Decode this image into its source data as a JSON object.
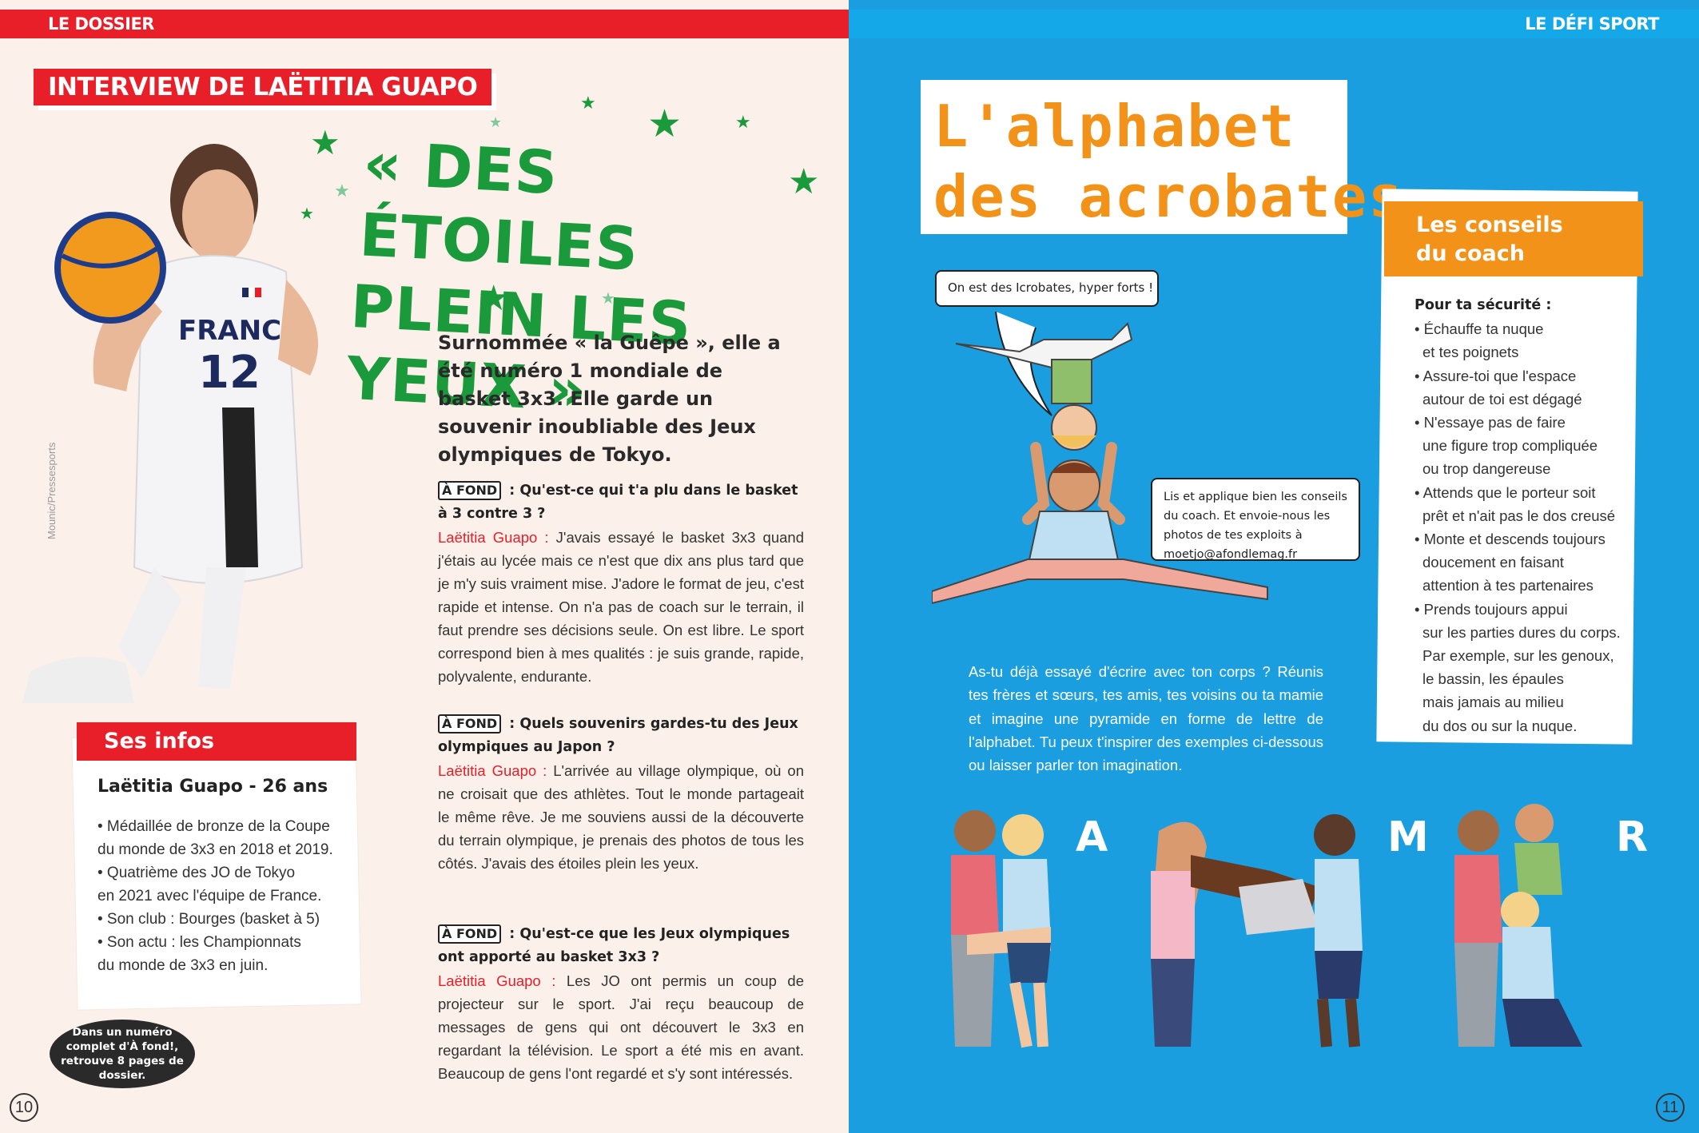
{
  "header": {
    "left_section": "LE DOSSIER",
    "right_section": "LE DÉFI SPORT"
  },
  "colors": {
    "red": "#e81e28",
    "green": "#1b9a3c",
    "blue": "#1a9ee0",
    "orange": "#f39218"
  },
  "left_page": {
    "tag": "INTERVIEW DE LAËTITIA GUAPO",
    "headline_line1": "« DES ÉTOILES",
    "headline_line2": "PLEIN LES YEUX »",
    "photo_credit": "Mounic/Pressesports",
    "jersey_text": "FRANCE",
    "jersey_number": "12",
    "intro": "Surnommée « la Guêpe », elle a été numéro 1 mondiale de basket 3x3. Elle garde un souvenir inoubliable des Jeux olympiques de Tokyo.",
    "qa": [
      {
        "badge": "À FOND",
        "question": " : Qu'est-ce qui t'a plu dans le basket à 3 contre 3 ?",
        "speaker": "Laëtitia Guapo :",
        "answer": " J'avais essayé le basket 3x3 quand j'étais au lycée mais ce n'est que dix ans plus tard que je m'y suis vraiment mise. J'adore le format de jeu, c'est rapide et intense. On n'a pas de coach sur le terrain, il faut prendre ses décisions seule. On est libre. Le sport correspond bien à mes qualités : je suis grande, rapide, polyvalente, endurante."
      },
      {
        "badge": "À FOND",
        "question": " : Quels souvenirs gardes-tu des Jeux olympiques au Japon ?",
        "speaker": "Laëtitia Guapo :",
        "answer": " L'arrivée au village olympique, où on ne croisait que des athlètes. Tout le monde partageait le même rêve. Je me souviens aussi de la découverte du terrain olympique, je prenais des photos de tous les côtés. J'avais des étoiles plein les yeux."
      },
      {
        "badge": "À FOND",
        "question": " : Qu'est-ce que les Jeux olympiques ont apporté au basket 3x3 ?",
        "speaker": "Laëtitia Guapo :",
        "answer": " Les JO ont permis un coup de projecteur sur le sport. J'ai reçu beaucoup de messages de gens qui ont découvert le 3x3 en regardant la télévision. Le sport a été mis en avant. Beaucoup de gens l'ont regardé et s'y sont intéressés."
      }
    ],
    "infos": {
      "title": "Ses infos",
      "name": "Laëtitia Guapo - 26 ans",
      "items": [
        [
          "• Médaillée de bronze de la Coupe",
          "du monde de 3x3 en 2018 et 2019."
        ],
        [
          "• Quatrième des JO de Tokyo",
          "en 2021 avec l'équipe de France."
        ],
        [
          "• Son club : Bourges (basket à 5)"
        ],
        [
          "• Son actu : les Championnats",
          "du monde de 3x3 en juin."
        ]
      ]
    },
    "bubble": "Dans un numéro complet d'À fond!, retrouve 8 pages de dossier.",
    "page_number": "10"
  },
  "right_page": {
    "title_line1": "L'alphabet",
    "title_line2": "des acrobates",
    "speech1": "On est des Icrobates, hyper forts !",
    "speech2": "Lis et applique bien les conseils du coach. Et envoie-nous les photos de tes exploits à moetjo@afondlemag.fr",
    "coach": {
      "title_line1": "Les conseils",
      "title_line2": "du coach",
      "head": "Pour ta sécurité :",
      "items": [
        [
          "• Échauffe ta nuque",
          "et tes poignets"
        ],
        [
          "• Assure-toi que l'espace",
          "autour de toi est dégagé"
        ],
        [
          "• N'essaye pas de faire",
          "une figure trop compliquée",
          "ou trop dangereuse"
        ],
        [
          "• Attends que le porteur soit",
          "prêt et n'ait pas le dos creusé"
        ],
        [
          "• Monte et descends toujours",
          "doucement en faisant",
          "attention à tes partenaires"
        ],
        [
          "• Prends toujours appui",
          "sur les parties dures du corps.",
          "Par exemple, sur les genoux,",
          "le bassin, les épaules",
          "mais jamais au milieu",
          "du dos ou sur la nuque."
        ]
      ]
    },
    "write_text": "As-tu déjà essayé d'écrire avec ton corps ? Réunis tes frères et sœurs, tes amis, tes voisins ou ta mamie et imagine une pyramide en forme de lettre de l'alphabet. Tu peux t'inspirer des exemples ci-dessous ou laisser parler ton imagination.",
    "letters": [
      "A",
      "M",
      "R"
    ],
    "page_number": "11"
  }
}
